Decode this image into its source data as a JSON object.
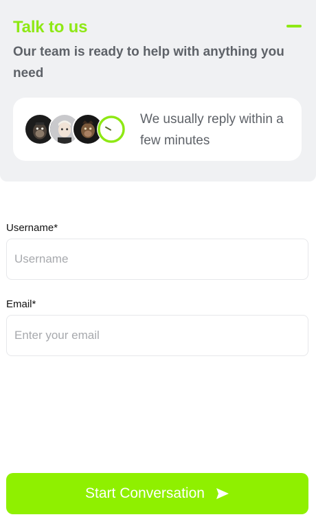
{
  "header": {
    "title": "Talk to us",
    "subtitle": "Our team is ready to help with anything you need",
    "minimize_icon": "minus-icon",
    "accent_color": "#8ee814"
  },
  "reply_card": {
    "avatars": [
      "avatar-1",
      "avatar-2",
      "avatar-3"
    ],
    "clock_icon": "clock-icon",
    "text": "We usually reply within a few minutes"
  },
  "form": {
    "username": {
      "label": "Username*",
      "placeholder": "Username",
      "value": ""
    },
    "email": {
      "label": "Email*",
      "placeholder": "Enter your email",
      "value": ""
    }
  },
  "start_button": {
    "label": "Start Conversation",
    "icon": "send-icon",
    "color": "#8ff000"
  }
}
